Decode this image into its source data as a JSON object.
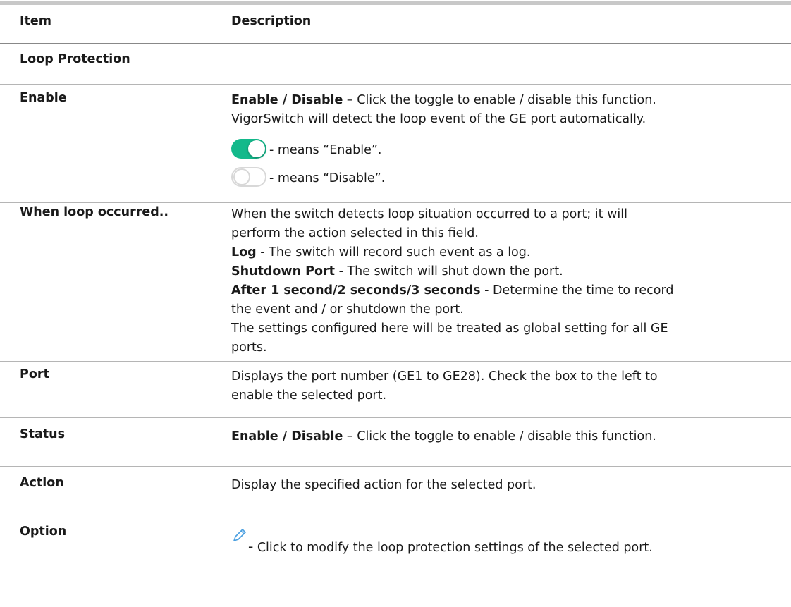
{
  "header": {
    "item": "Item",
    "description": "Description"
  },
  "section_title": "Loop Protection",
  "enable": {
    "item": "Enable",
    "line1_bold": "Enable / Disable",
    "line1_rest": " – Click the toggle to enable / disable this function.",
    "line2": "VigorSwitch will detect the loop event of the GE port automatically.",
    "on_text": "- means “Enable”.",
    "off_text": "- means “Disable”."
  },
  "loop": {
    "item": "When loop occurred..",
    "line1": "When the switch detects loop situation occurred to a port; it will",
    "line2": "perform the action selected in this field.",
    "log_bold": "Log",
    "log_rest": " - The switch will record such event as a log.",
    "shutdown_bold": "Shutdown Port",
    "shutdown_rest": " - The switch will shut down the port.",
    "after_bold": "After 1 second/2 seconds/3 seconds",
    "after_rest": " - Determine the time to record",
    "after_line2": "the event and / or shutdown the port.",
    "global_line1": "The settings configured here will be treated as global setting for all GE",
    "global_line2": "ports."
  },
  "port": {
    "item": "Port",
    "line1": "Displays the port number (GE1 to GE28). Check the box to the left to",
    "line2": "enable the selected port."
  },
  "status": {
    "item": "Status",
    "bold": "Enable / Disable",
    "rest": " – Click the toggle to enable / disable this function."
  },
  "action": {
    "item": "Action",
    "text": "Display the specified action for the selected port."
  },
  "option": {
    "item": "Option",
    "bold": "-",
    "rest": " Click to modify the loop protection settings of the selected port.",
    "icon": "pencil-icon"
  },
  "colors": {
    "toggle_on": "#13b98b",
    "pencil": "#4a9fe0"
  }
}
